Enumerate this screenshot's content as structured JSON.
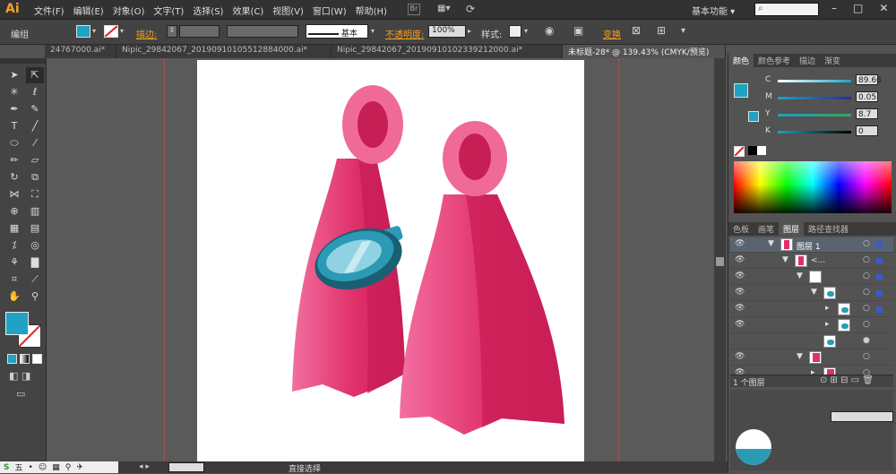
{
  "app": {
    "logo": "Ai",
    "workspace": "基本功能",
    "search_placeholder": ""
  },
  "menu": [
    "文件(F)",
    "编辑(E)",
    "对象(O)",
    "文字(T)",
    "选择(S)",
    "效果(C)",
    "视图(V)",
    "窗口(W)",
    "帮助(H)"
  ],
  "control": {
    "selection_label": "编组",
    "stroke_label": "描边:",
    "stroke_style": "基本",
    "opacity_label": "不透明度:",
    "opacity_value": "100%",
    "style_label": "样式:",
    "transform_label": "变换"
  },
  "doc_tabs": [
    {
      "label": "24767000.ai*",
      "active": false
    },
    {
      "label": "Nipic_29842067_20190910105512884000.ai*",
      "active": false
    },
    {
      "label": "Nipic_29842067_20190910102339212000.ai*",
      "active": false
    },
    {
      "label": "未标题-28* @ 139.43% (CMYK/预览)",
      "active": true
    }
  ],
  "color_panel": {
    "tabs": [
      "颜色",
      "颜色参考",
      "描边",
      "渐变"
    ],
    "channels": [
      {
        "name": "C",
        "value": "89.66",
        "color": "#1aa3c0"
      },
      {
        "name": "M",
        "value": "0.05",
        "color": "#2a2a9a"
      },
      {
        "name": "Y",
        "value": "8.7",
        "color": "#3aa060"
      },
      {
        "name": "K",
        "value": "0",
        "color": "#aaaaaa"
      }
    ],
    "fill_color": "#1fa3c2"
  },
  "layers_panel": {
    "tabs": [
      "色板",
      "画笔",
      "图层",
      "路径查找器"
    ],
    "rows": [
      {
        "label": "图层 1"
      },
      {
        "label": "<..."
      },
      {
        "label": ""
      },
      {
        "label": ""
      },
      {
        "label": ""
      },
      {
        "label": ""
      },
      {
        "label": ""
      },
      {
        "label": ""
      },
      {
        "label": ""
      }
    ],
    "footer": "1 个图层"
  },
  "status": {
    "zoom": "",
    "tool": "直接选择"
  },
  "colors": {
    "fin_pink": "#e0306a",
    "fin_light": "#f06a98",
    "fin_dark": "#b81a50",
    "goggle": "#2a9ab5"
  }
}
